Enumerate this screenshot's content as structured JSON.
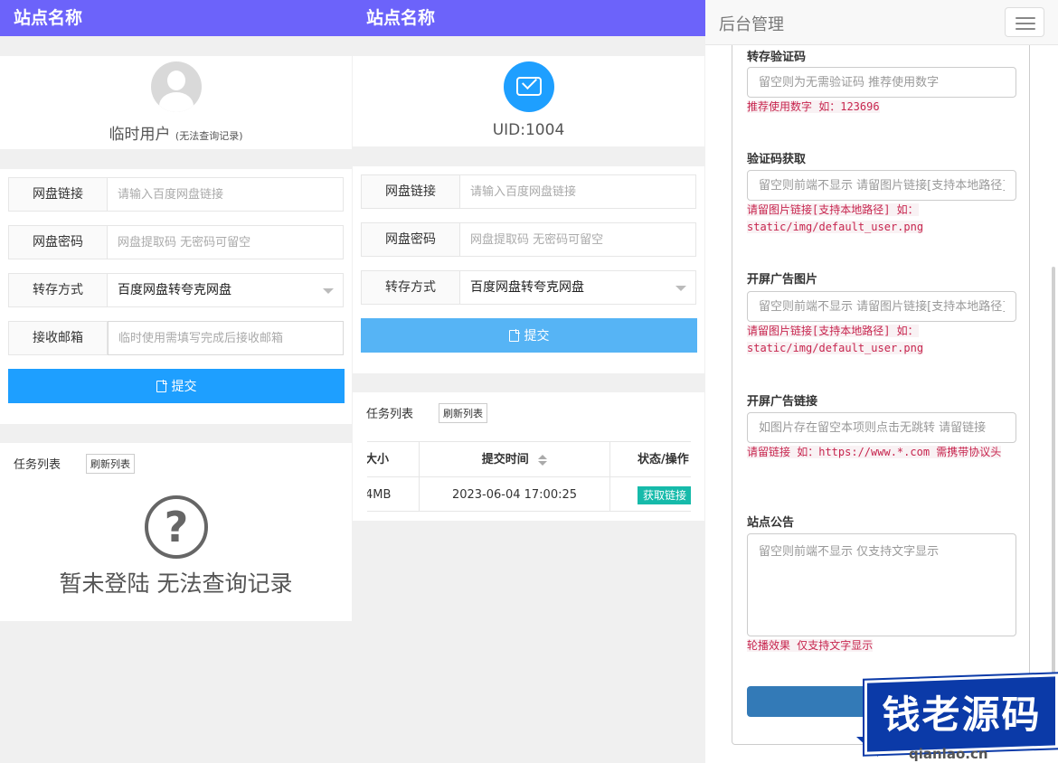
{
  "panel1": {
    "site_title": "站点名称",
    "user_name": "临时用户",
    "user_note": "(无法查询记录)",
    "form": {
      "link_label": "网盘链接",
      "link_placeholder": "请输入百度网盘链接",
      "pwd_label": "网盘密码",
      "pwd_placeholder": "网盘提取码 无密码可留空",
      "mode_label": "转存方式",
      "mode_value": "百度网盘转夸克网盘",
      "email_label": "接收邮箱",
      "email_placeholder": "临时使用需填写完成后接收邮箱",
      "submit_label": "提交"
    },
    "tasks": {
      "title": "任务列表",
      "refresh_label": "刷新列表",
      "empty_message": "暂未登陆 无法查询记录"
    }
  },
  "panel2": {
    "site_title": "站点名称",
    "uid": "UID:1004",
    "form": {
      "link_label": "网盘链接",
      "link_placeholder": "请输入百度网盘链接",
      "pwd_label": "网盘密码",
      "pwd_placeholder": "网盘提取码 无密码可留空",
      "mode_label": "转存方式",
      "mode_value": "百度网盘转夸克网盘",
      "submit_label": "提交"
    },
    "tasks": {
      "title": "任务列表",
      "refresh_label": "刷新列表",
      "columns": [
        "大小",
        "提交时间",
        "状态/操作"
      ],
      "rows": [
        {
          "size": "4MB",
          "time": "2023-06-04 17:00:25",
          "action": "获取链接"
        }
      ]
    }
  },
  "panel3": {
    "title": "后台管理",
    "fields": [
      {
        "label": "转存验证码",
        "placeholder": "留空则为无需验证码 推荐使用数字",
        "help": "推荐使用数字 如：123696"
      },
      {
        "label": "验证码获取",
        "placeholder": "留空则前端不显示 请留图片链接[支持本地路径]",
        "help": "请留图片链接[支持本地路径] 如：static/img/default_user.png"
      },
      {
        "label": "开屏广告图片",
        "placeholder": "留空则前端不显示 请留图片链接[支持本地路径]",
        "help": "请留图片链接[支持本地路径] 如：static/img/default_user.png"
      },
      {
        "label": "开屏广告链接",
        "placeholder": "如图片存在留空本项则点击无跳转 请留链接",
        "help": "请留链接 如：https://www.*.com 需携带协议头"
      },
      {
        "label": "站点公告",
        "placeholder": "留空则前端不显示 仅支持文字显示",
        "help": "轮播效果 仅支持文字显示"
      }
    ]
  },
  "watermark": {
    "text": "钱老源码",
    "url": "qianlao.cn"
  }
}
